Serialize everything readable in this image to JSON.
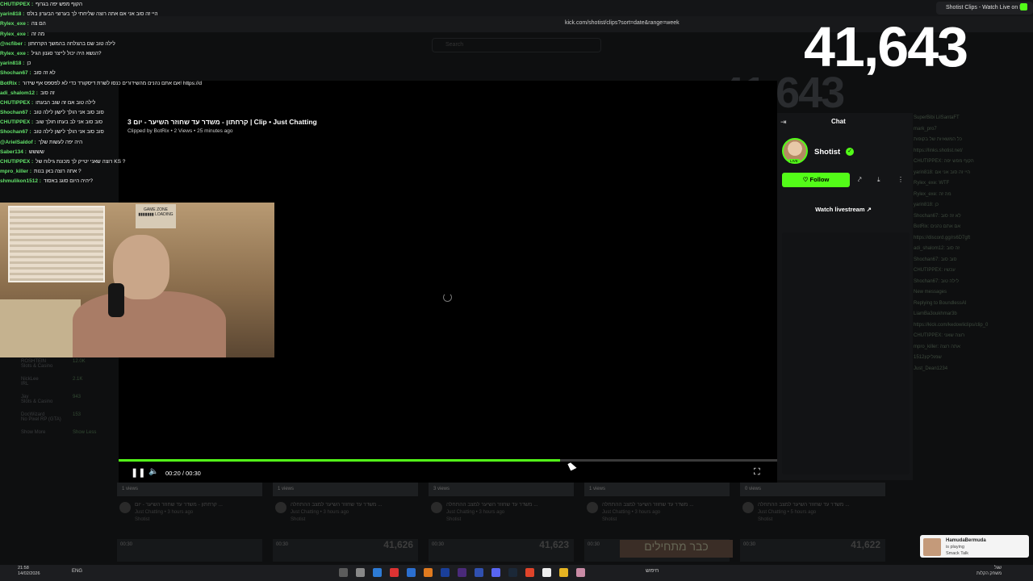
{
  "browser": {
    "tab_title": "Shotist Clips - Watch Live on Kic",
    "url": "kick.com/shotist/clips?sort=date&range=week",
    "search_placeholder": "Search"
  },
  "viewer_count": {
    "big": "41,643",
    "ghost": "41,643"
  },
  "chat_overlay": [
    {
      "user": "CHUTIPPEX :",
      "text": "הקוף מפש יפה בגרוף"
    },
    {
      "user": "yarin818 :",
      "text": "היי זה סוב אני אם אתה רוצה שליחתי לך בערוצי הבערון בולס"
    },
    {
      "user": "Rylex_exe :",
      "text": "הם צה"
    },
    {
      "user": "Rylex_exe :",
      "text": "מה זה"
    },
    {
      "user": "@ncfiber :",
      "text": "לילה טוב שם בהצלחה בהמשך הקרחתון"
    },
    {
      "user": "Rylex_exe :",
      "text": "הנשא היה יכול לייצר סגנון הגיל?"
    },
    {
      "user": "yarin818 :",
      "text": "כן"
    },
    {
      "user": "Shochan67 :",
      "text": "לא זה סוב"
    },
    {
      "user": "BotRix :",
      "text": "אם אתם נהנים מהשידורים כנסו לשרת דיסקורד כדי לא לפספס אף שידור! https://discord.gg/rs6D7gft"
    },
    {
      "user": "adi_shalom12 :",
      "text": "זה סוב"
    },
    {
      "user": "CHUTIPPEX :",
      "text": "לילה טוב אם זה שוב הבעתו"
    },
    {
      "user": "Shochan67 :",
      "text": "סוב סוב אני הולך לישון לילה טוב"
    },
    {
      "user": "CHUTIPPEX :",
      "text": "סוב סוב אני לב בעתו חולך שוב"
    },
    {
      "user": "Shochan67 :",
      "text": "סוב סוב אני הולך לישון לילה טוב"
    },
    {
      "user": "@ArielSaldof :",
      "text": "היה יפה לעשות שלך"
    },
    {
      "user": "Saber134 :",
      "text": "שששש"
    },
    {
      "user": "CHUTIPPEX :",
      "text": "רוצה שאני יטייק לך מכונת גילוח של KS ?"
    },
    {
      "user": "mpro_killer :",
      "text": "אתה רוצה באן בנות ?"
    },
    {
      "user": "shmulikon1512 :",
      "text": "יהיה היום סוגנ באסוד?"
    }
  ],
  "clip": {
    "title": "3 קרחתון - משדר עד שחוזר השיער - יום | Clip • Just Chatting",
    "meta": "Clipped by BotRix • 2 Views • 25 minutes ago",
    "current_time": "00:20",
    "duration": "00:30",
    "time_display": "00:20 / 00:30",
    "progress": 0.67
  },
  "webcam": {
    "poster_text": "GAME ZONE\n▮▮▮▮▮▮▮\nLOADING"
  },
  "side_panel": {
    "chat_label": "Chat",
    "streamer_name": "Shotist",
    "live_label": "LIVE",
    "follow_label": "Follow",
    "watch_label": "Watch livestream"
  },
  "left_list": [
    {
      "name": "ROSHTEIN",
      "sub": "Slots & Casino",
      "count": "12.0K"
    },
    {
      "name": "NickLee",
      "sub": "IRL",
      "count": "2.1K"
    },
    {
      "name": "Jay",
      "sub": "Slots & Casino",
      "count": "943"
    },
    {
      "name": "DocWizard",
      "sub": "No Pixel RP (GTA)",
      "count": "153"
    },
    {
      "name": "Show More",
      "sub": "",
      "count": "Show Less"
    }
  ],
  "clip_cards": [
    {
      "views": "1 views",
      "title": "קרחתון - משדר עד שחוזר השיער - יום ...",
      "category": "Just Chatting • 3 hours ago",
      "by": "Shotist"
    },
    {
      "views": "1 views",
      "title": "משדר עד שחוזר השיער למצב ההתחלה ...",
      "category": "Just Chatting • 3 hours ago",
      "by": "Shotist"
    },
    {
      "views": "3 views",
      "title": "משדר עד שחוזר השיער למצב ההתחלה ...",
      "category": "Just Chatting • 3 hours ago",
      "by": "Shotist"
    },
    {
      "views": "1 views",
      "title": "משדר עד שחוזר השיער למצב ההתחלה ...",
      "category": "Just Chatting • 3 hours ago",
      "by": "Shotist"
    },
    {
      "views": "0 views",
      "title": "משדר עד שחוזר השיער למצב ההתחלה ...",
      "category": "Just Chatting • 5 hours ago",
      "by": "Shotist"
    }
  ],
  "lower_cards": [
    {
      "duration": "00:30",
      "count": ""
    },
    {
      "duration": "00:30",
      "count": "41,626"
    },
    {
      "duration": "00:30",
      "count": "41,623"
    },
    {
      "duration": "00:30",
      "count": ""
    },
    {
      "duration": "00:30",
      "count": "41,622"
    }
  ],
  "hebrew_banner": "כבר מתחילים",
  "right_chat": [
    "SuperBibi  LilSantaFT",
    "mark_pro7",
    "כל המשאיות של בקופות",
    "https://links.shotist.net/",
    "CHUTIPPEX: הקוף מפש יפה",
    "yarin818: היי זה סוב אני אם",
    "Rylex_exe: WTF",
    "Rylex_exe: מה זה",
    "yarin818: כן",
    "Shochan67: לא זה סוב",
    "BotRix: אם אתם נהנים",
    "https://discord.gg/rs6D7gft",
    "adi_shalom12: זה סוב",
    "Shochan67: סוב סוב",
    "CHUTIPPEX: עכשיו",
    "Shochan67: לילה טוב",
    "New messages",
    "Replying to BoundlessAI",
    "LiamBa3oukhmar3b",
    "https://kick.com/kedowliclips/clip_0",
    "CHUTIPPEX: רוצה שאני",
    "mpro_killer: אתה רוצה",
    "שמוליקון1512",
    "Just_Dean1234"
  ],
  "toast": {
    "name": "HamudaBermuda",
    "line2": "is playing",
    "line3": "Smack Talk"
  },
  "taskbar": {
    "time": "21:58",
    "date": "14/02/2026",
    "lang": "ENG",
    "search": "חיפוש",
    "right_l1": "שגל",
    "right_l2": "משחק הקלות"
  }
}
